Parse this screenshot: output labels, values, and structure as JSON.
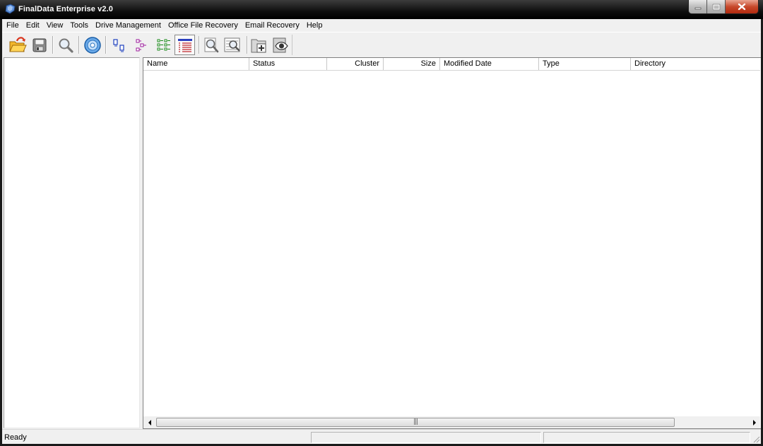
{
  "window": {
    "title": "FinalData Enterprise v2.0"
  },
  "menu": [
    "File",
    "Edit",
    "View",
    "Tools",
    "Drive Management",
    "Office File Recovery",
    "Email Recovery",
    "Help"
  ],
  "toolbar": {
    "buttons": [
      {
        "name": "open-icon"
      },
      {
        "name": "save-icon"
      },
      {
        "name": "find-icon"
      },
      {
        "name": "scan-disc-icon"
      },
      {
        "name": "large-icons-view-icon"
      },
      {
        "name": "small-icons-view-icon"
      },
      {
        "name": "list-view-icon"
      },
      {
        "name": "details-view-icon",
        "pressed": true
      },
      {
        "name": "file-preview-icon"
      },
      {
        "name": "search-result-icon"
      },
      {
        "name": "add-folder-icon"
      },
      {
        "name": "view-file-icon"
      }
    ]
  },
  "file_list": {
    "columns": [
      {
        "label": "Name",
        "align": "left"
      },
      {
        "label": "Status",
        "align": "left"
      },
      {
        "label": "Cluster",
        "align": "right"
      },
      {
        "label": "Size",
        "align": "right"
      },
      {
        "label": "Modified Date",
        "align": "left"
      },
      {
        "label": "Type",
        "align": "left"
      },
      {
        "label": "Directory",
        "align": "left"
      }
    ],
    "rows": []
  },
  "status_bar": {
    "text": "Ready"
  }
}
